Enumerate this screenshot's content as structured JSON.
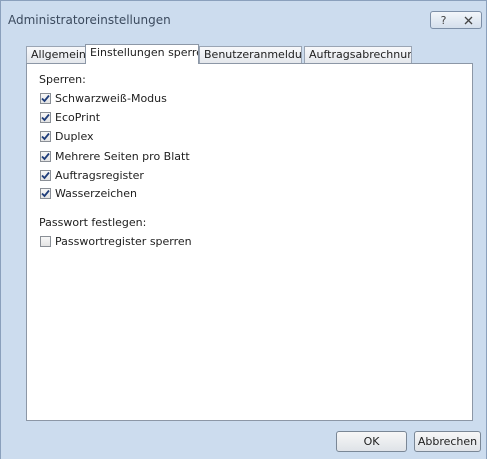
{
  "window": {
    "title": "Administratoreinstellungen",
    "help_glyph": "?"
  },
  "tabs": [
    {
      "label": "Allgemein",
      "active": false
    },
    {
      "label": "Einstellungen sperren",
      "active": true
    },
    {
      "label": "Benutzeranmeldung",
      "active": false
    },
    {
      "label": "Auftragsabrechnung",
      "active": false
    }
  ],
  "lock_group": {
    "label": "Sperren:",
    "items": [
      {
        "label": "Schwarzweiß-Modus",
        "checked": true
      },
      {
        "label": "EcoPrint",
        "checked": true
      },
      {
        "label": "Duplex",
        "checked": true
      },
      {
        "label": "Mehrere Seiten pro Blatt",
        "checked": true
      },
      {
        "label": "Auftragsregister",
        "checked": true
      },
      {
        "label": "Wasserzeichen",
        "checked": true
      }
    ]
  },
  "password_group": {
    "label": "Passwort festlegen:",
    "items": [
      {
        "label": "Passwortregister sperren",
        "checked": false
      }
    ]
  },
  "buttons": {
    "ok": "OK",
    "cancel": "Abbrechen"
  },
  "colors": {
    "frame": "#ccdcee",
    "check": "#1f3d7a"
  }
}
